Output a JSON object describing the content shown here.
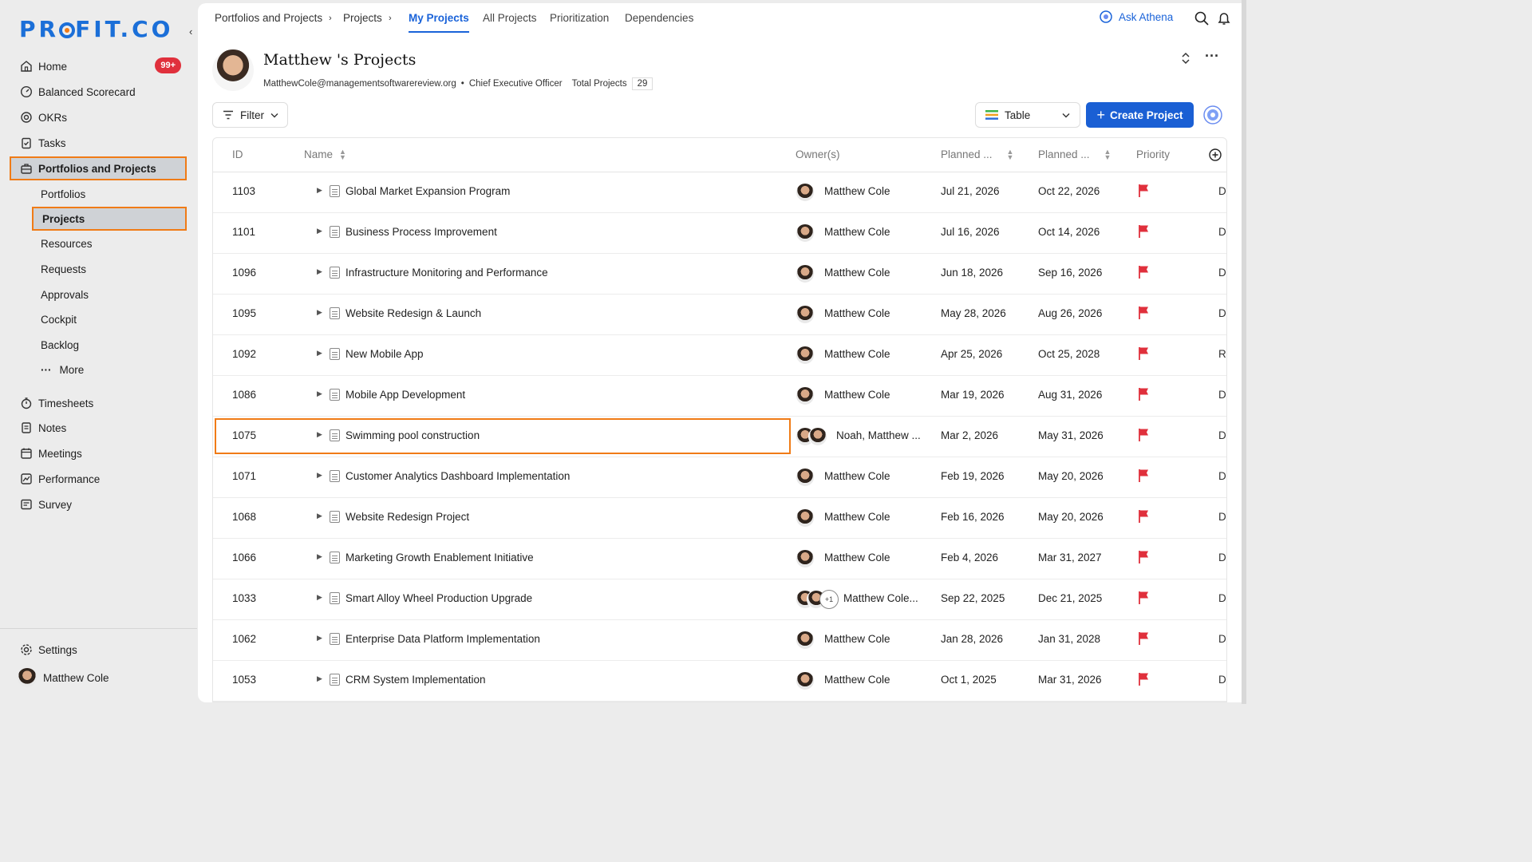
{
  "sidebar": {
    "logo": "PROFIT.CO",
    "items": [
      {
        "label": "Home",
        "badge": "99+"
      },
      {
        "label": "Balanced Scorecard"
      },
      {
        "label": "OKRs"
      },
      {
        "label": "Tasks"
      },
      {
        "label": "Portfolios and Projects"
      },
      {
        "label": "Portfolios"
      },
      {
        "label": "Projects"
      },
      {
        "label": "Resources"
      },
      {
        "label": "Requests"
      },
      {
        "label": "Approvals"
      },
      {
        "label": "Cockpit"
      },
      {
        "label": "Backlog"
      },
      {
        "label": "More"
      },
      {
        "label": "Timesheets"
      },
      {
        "label": "Notes"
      },
      {
        "label": "Meetings"
      },
      {
        "label": "Performance"
      },
      {
        "label": "Survey"
      }
    ],
    "settings": "Settings",
    "user": "Matthew Cole"
  },
  "topbar": {
    "crumbs": [
      "Portfolios and Projects",
      "Projects"
    ],
    "tabs": [
      "My Projects",
      "All Projects",
      "Prioritization",
      "Dependencies"
    ],
    "ask": "Ask Athena"
  },
  "profile": {
    "title": "Matthew 's Projects",
    "email": "MatthewCole@managementsoftwarereview.org",
    "role": "Chief Executive Officer",
    "total_label": "Total Projects",
    "total": "29"
  },
  "toolbar": {
    "filter": "Filter",
    "view": "Table",
    "create": "Create Project"
  },
  "table": {
    "headers": [
      "ID",
      "Name",
      "Owner(s)",
      "Planned ...",
      "Planned ...",
      "Priority"
    ],
    "rows": [
      {
        "id": "1103",
        "name": "Global Market Expansion Program",
        "owner": "Matthew Cole",
        "start": "Jul 21, 2026",
        "end": "Oct 22, 2026",
        "last": "D"
      },
      {
        "id": "1101",
        "name": "Business Process Improvement",
        "owner": "Matthew Cole",
        "start": "Jul 16, 2026",
        "end": "Oct 14, 2026",
        "last": "D"
      },
      {
        "id": "1096",
        "name": "Infrastructure Monitoring and Performance",
        "owner": "Matthew Cole",
        "start": "Jun 18, 2026",
        "end": "Sep 16, 2026",
        "last": "D"
      },
      {
        "id": "1095",
        "name": "Website Redesign & Launch",
        "owner": "Matthew Cole",
        "start": "May 28, 2026",
        "end": "Aug 26, 2026",
        "last": "D"
      },
      {
        "id": "1092",
        "name": "New Mobile App",
        "owner": "Matthew Cole",
        "start": "Apr 25, 2026",
        "end": "Oct 25, 2028",
        "last": "R"
      },
      {
        "id": "1086",
        "name": "Mobile App Development",
        "owner": "Matthew Cole",
        "start": "Mar 19, 2026",
        "end": "Aug 31, 2026",
        "last": "D"
      },
      {
        "id": "1075",
        "name": "Swimming pool construction",
        "owner": "Noah, Matthew ...",
        "start": "Mar 2, 2026",
        "end": "May 31, 2026",
        "last": "D"
      },
      {
        "id": "1071",
        "name": "Customer Analytics Dashboard Implementation",
        "owner": "Matthew Cole",
        "start": "Feb 19, 2026",
        "end": "May 20, 2026",
        "last": "D"
      },
      {
        "id": "1068",
        "name": "Website Redesign Project",
        "owner": "Matthew Cole",
        "start": "Feb 16, 2026",
        "end": "May 20, 2026",
        "last": "D"
      },
      {
        "id": "1066",
        "name": "Marketing Growth Enablement Initiative",
        "owner": "Matthew Cole",
        "start": "Feb 4, 2026",
        "end": "Mar 31, 2027",
        "last": "D"
      },
      {
        "id": "1033",
        "name": "Smart Alloy Wheel Production Upgrade",
        "owner": "Matthew Cole...",
        "extra": "+1",
        "start": "Sep 22, 2025",
        "end": "Dec 21, 2025",
        "last": "D"
      },
      {
        "id": "1062",
        "name": "Enterprise Data Platform Implementation",
        "owner": "Matthew Cole",
        "start": "Jan 28, 2026",
        "end": "Jan 31, 2028",
        "last": "D"
      },
      {
        "id": "1053",
        "name": "CRM System Implementation",
        "owner": "Matthew Cole",
        "start": "Oct 1, 2025",
        "end": "Mar 31, 2026",
        "last": "D"
      }
    ]
  },
  "colors": {
    "accent": "#1a63d9",
    "highlight": "#f07b16",
    "flag": "#e0303c"
  }
}
